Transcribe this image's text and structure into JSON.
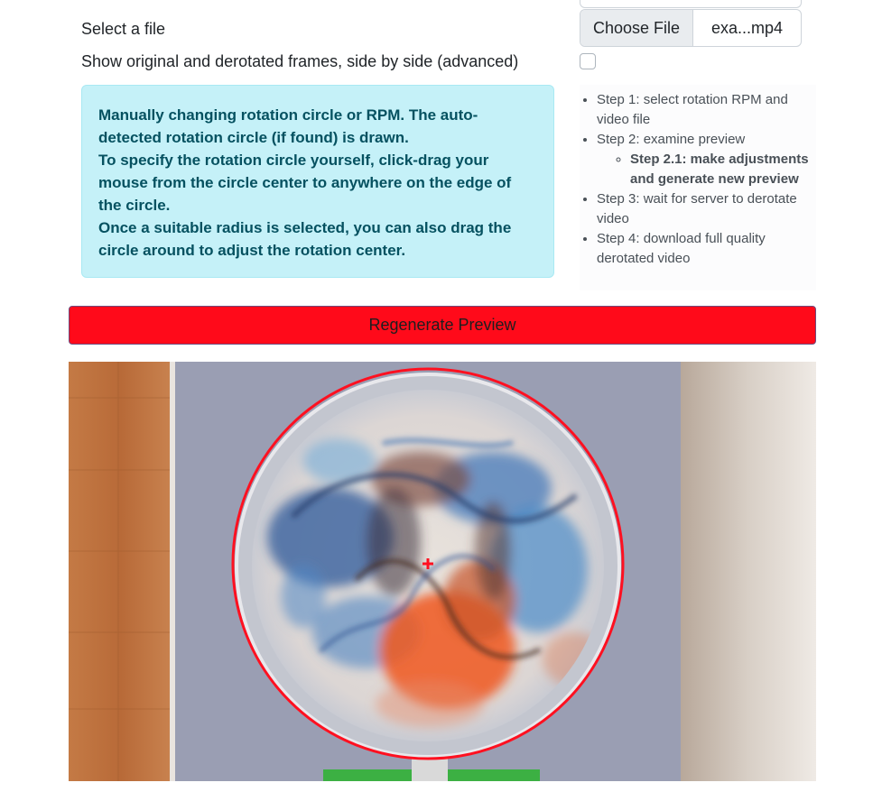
{
  "file_row": {
    "label": "Select a file",
    "choose_button": "Choose File",
    "file_name": "exa...mp4"
  },
  "side_by_side": {
    "label": "Show original and derotated frames, side by side (advanced)",
    "checked": false
  },
  "alert": {
    "line1": "Manually changing rotation circle or RPM. The auto-detected rotation circle (if found) is drawn.",
    "line2": "To specify the rotation circle yourself, click-drag your mouse from the circle center to anywhere on the edge of the circle.",
    "line3": "Once a suitable radius is selected, you can also drag the circle around to adjust the rotation center."
  },
  "steps": {
    "step1": "Step 1: select rotation RPM and video file",
    "step2": "Step 2: examine preview",
    "step2_1": "Step 2.1: make adjustments and generate new preview",
    "step3": "Step 3: wait for server to derotate video",
    "step4": "Step 4: download full quality derotated video"
  },
  "regenerate_button": "Regenerate Preview",
  "colors": {
    "alert_bg": "#c5f1f8",
    "alert_text": "#055160",
    "button_bg": "#ff0a1a",
    "circle": "#ff1020"
  }
}
